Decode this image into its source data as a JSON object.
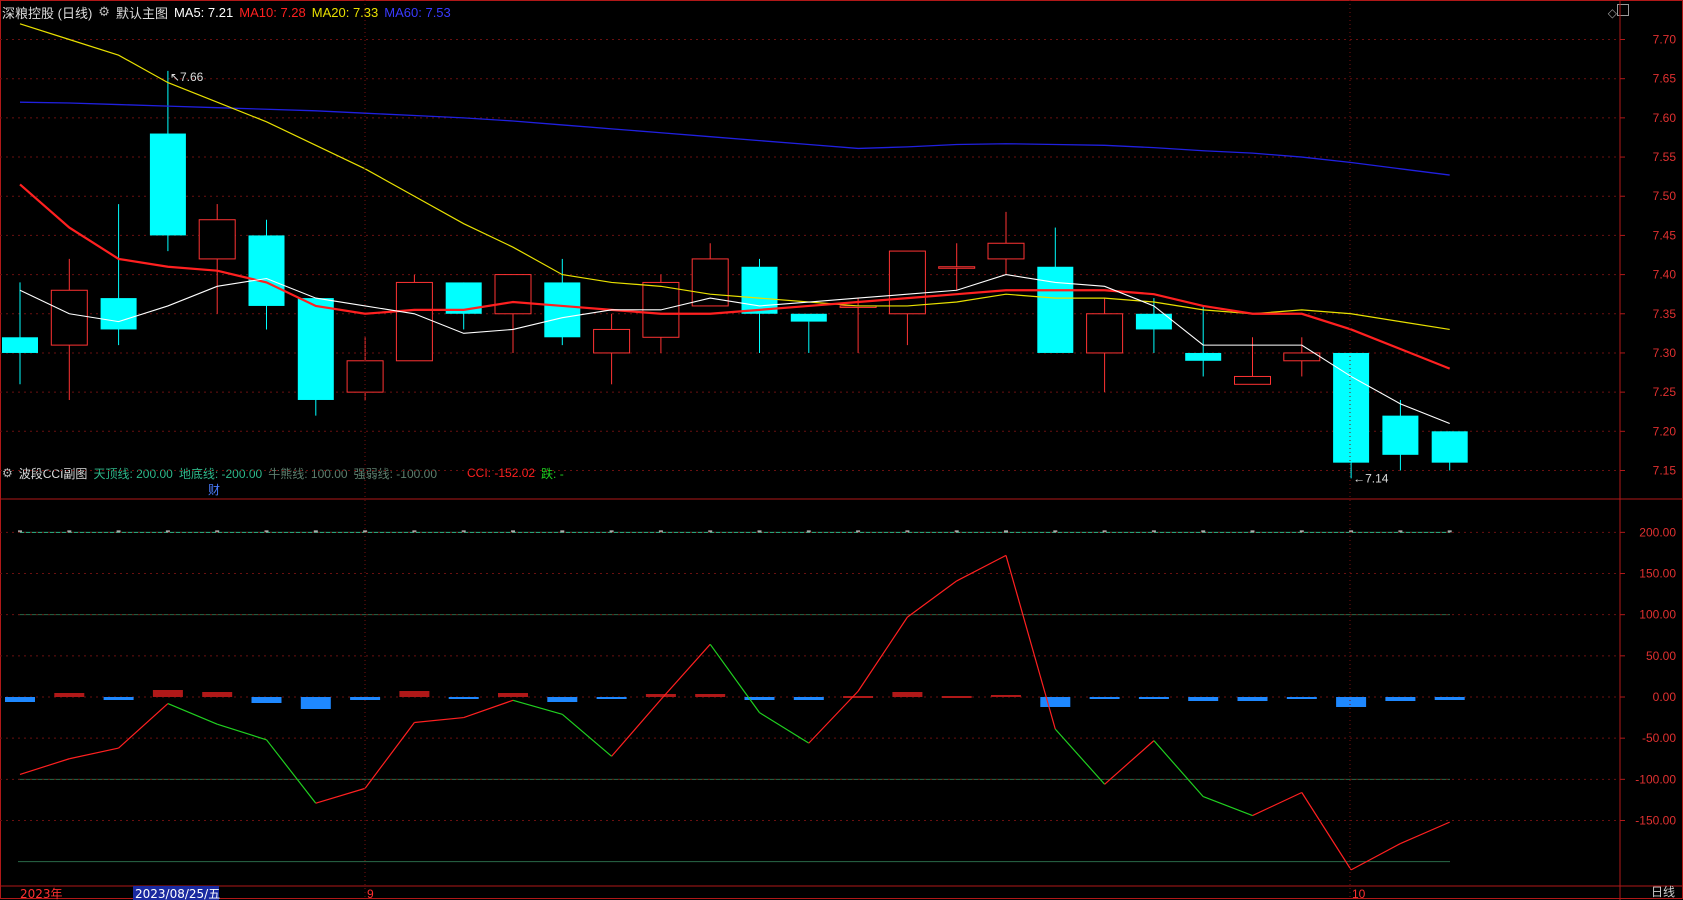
{
  "header": {
    "stock": "深粮控股 (日线)",
    "main_chart": "默认主图",
    "ma": [
      {
        "label": "MA5:",
        "value": "7.21",
        "color": "#ffffff"
      },
      {
        "label": "MA10:",
        "value": "7.28",
        "color": "#ff2020"
      },
      {
        "label": "MA20:",
        "value": "7.33",
        "color": "#e8e000"
      },
      {
        "label": "MA60:",
        "value": "7.53",
        "color": "#2a2aff"
      }
    ]
  },
  "sub_header": {
    "title": "波段CCI副图",
    "items": [
      {
        "label": "天顶线:",
        "value": "200.00",
        "color": "#2fb88a"
      },
      {
        "label": "地底线:",
        "value": "-200.00",
        "color": "#2fb88a"
      },
      {
        "label": "牛熊线:",
        "value": "100.00",
        "color": "#5e7f6e"
      },
      {
        "label": "强弱线:",
        "value": "-100.00",
        "color": "#5e7f6e"
      },
      {
        "label": "CCI:",
        "value": "-152.02",
        "color": "#ff2020"
      },
      {
        "label": "跌:",
        "value": "-",
        "color": "#20d020"
      }
    ]
  },
  "annotations": {
    "high_label": "7.66",
    "low_label": "7.14",
    "fin_marker": "财"
  },
  "x_labels": [
    {
      "text": "2023年",
      "color": "#ff3030"
    },
    {
      "text": "2023/08/25/五",
      "color": "#ffffff",
      "highlight": true
    },
    {
      "text": "9",
      "color": "#ff3030"
    },
    {
      "text": "10",
      "color": "#ff3030"
    }
  ],
  "period_tab": "日线",
  "colors": {
    "up": "#ff3333",
    "down": "#00ffff",
    "ma5": "#ffffff",
    "ma10": "#ff2020",
    "ma20": "#e8e000",
    "ma60": "#2020e0",
    "axis": "#b01818"
  },
  "chart_data": [
    {
      "type": "candlestick",
      "title": "深粮控股 (日线)",
      "ylim": [
        7.12,
        7.73
      ],
      "y_ticks": [
        7.15,
        7.2,
        7.25,
        7.3,
        7.35,
        7.4,
        7.45,
        7.5,
        7.55,
        7.6,
        7.65,
        7.7
      ],
      "ohlc": [
        [
          7.32,
          7.39,
          7.26,
          7.3
        ],
        [
          7.31,
          7.42,
          7.24,
          7.38
        ],
        [
          7.37,
          7.49,
          7.31,
          7.33
        ],
        [
          7.58,
          7.66,
          7.43,
          7.45
        ],
        [
          7.42,
          7.49,
          7.35,
          7.47
        ],
        [
          7.45,
          7.47,
          7.33,
          7.36
        ],
        [
          7.37,
          7.37,
          7.22,
          7.24
        ],
        [
          7.25,
          7.32,
          7.24,
          7.29
        ],
        [
          7.29,
          7.4,
          7.29,
          7.39
        ],
        [
          7.39,
          7.39,
          7.33,
          7.35
        ],
        [
          7.35,
          7.4,
          7.3,
          7.4
        ],
        [
          7.39,
          7.42,
          7.31,
          7.32
        ],
        [
          7.3,
          7.35,
          7.26,
          7.33
        ],
        [
          7.32,
          7.4,
          7.3,
          7.39
        ],
        [
          7.36,
          7.44,
          7.36,
          7.42
        ],
        [
          7.41,
          7.42,
          7.3,
          7.35
        ],
        [
          7.35,
          7.34,
          7.3,
          7.34
        ],
        [
          7.36,
          7.37,
          7.3,
          7.36
        ],
        [
          7.35,
          7.43,
          7.31,
          7.43
        ],
        [
          7.41,
          7.44,
          7.38,
          7.41
        ],
        [
          7.42,
          7.48,
          7.4,
          7.44
        ],
        [
          7.41,
          7.46,
          7.3,
          7.3
        ],
        [
          7.3,
          7.37,
          7.25,
          7.35
        ],
        [
          7.35,
          7.37,
          7.3,
          7.33
        ],
        [
          7.3,
          7.36,
          7.27,
          7.29
        ],
        [
          7.26,
          7.32,
          7.26,
          7.27
        ],
        [
          7.29,
          7.32,
          7.27,
          7.3
        ],
        [
          7.3,
          7.3,
          7.14,
          7.16
        ],
        [
          7.22,
          7.24,
          7.15,
          7.17
        ],
        [
          7.2,
          7.2,
          7.15,
          7.16
        ]
      ],
      "ma5": [
        7.38,
        7.35,
        7.34,
        7.36,
        7.385,
        7.395,
        7.37,
        7.36,
        7.35,
        7.325,
        7.33,
        7.345,
        7.355,
        7.355,
        7.37,
        7.36,
        7.365,
        7.37,
        7.375,
        7.38,
        7.4,
        7.39,
        7.385,
        7.36,
        7.31,
        7.31,
        7.31,
        7.27,
        7.235,
        7.21
      ],
      "ma10": [
        7.515,
        7.46,
        7.42,
        7.41,
        7.405,
        7.39,
        7.36,
        7.35,
        7.355,
        7.355,
        7.365,
        7.36,
        7.355,
        7.35,
        7.35,
        7.355,
        7.36,
        7.365,
        7.37,
        7.375,
        7.38,
        7.38,
        7.38,
        7.375,
        7.36,
        7.35,
        7.35,
        7.33,
        7.305,
        7.28
      ],
      "ma20": [
        7.72,
        7.7,
        7.68,
        7.645,
        7.62,
        7.595,
        7.565,
        7.535,
        7.5,
        7.465,
        7.435,
        7.4,
        7.39,
        7.385,
        7.375,
        7.37,
        7.365,
        7.36,
        7.36,
        7.365,
        7.375,
        7.37,
        7.37,
        7.365,
        7.355,
        7.35,
        7.355,
        7.35,
        7.34,
        7.33
      ],
      "ma60": [
        7.62,
        7.619,
        7.617,
        7.615,
        7.613,
        7.611,
        7.609,
        7.606,
        7.603,
        7.6,
        7.596,
        7.591,
        7.586,
        7.581,
        7.576,
        7.571,
        7.566,
        7.561,
        7.563,
        7.566,
        7.567,
        7.566,
        7.565,
        7.562,
        7.558,
        7.555,
        7.55,
        7.543,
        7.535,
        7.527
      ]
    },
    {
      "type": "line",
      "title": "波段CCI副图",
      "ylim": [
        -215,
        215
      ],
      "y_ticks": [
        200,
        150,
        100,
        50,
        0,
        -50,
        -100,
        -150
      ],
      "ref_lines": [
        200,
        100,
        -100,
        -200
      ],
      "cci": [
        -94,
        -75,
        -62,
        -8,
        -33,
        -52,
        -129,
        -111,
        -31,
        -25,
        -4,
        -21,
        -72,
        -3,
        64,
        -19,
        -56,
        7,
        97,
        141,
        172,
        -39,
        -106,
        -53,
        -121,
        -144,
        -116,
        -210,
        -178,
        -152
      ],
      "seg_colors": [
        "#ff2020",
        "#ff2020",
        "#ff2020",
        "#20d020",
        "#20d020",
        "#20d020",
        "#ff2020",
        "#ff2020",
        "#ff2020",
        "#ff2020",
        "#20d020",
        "#20d020",
        "#ff2020",
        "#ff2020",
        "#20d020",
        "#20d020",
        "#ff2020",
        "#ff2020",
        "#ff2020",
        "#ff2020",
        "#ff2020",
        "#20d020",
        "#ff2020",
        "#20d020",
        "#20d020",
        "#ff2020",
        "#ff2020",
        "#ff2020",
        "#ff2020"
      ],
      "bars": [
        -5,
        4,
        -3,
        7,
        5,
        -6,
        -12,
        -3,
        6,
        -1,
        4,
        -5,
        -2,
        3,
        3,
        -3,
        -3,
        1,
        5,
        1,
        2,
        -10,
        -2,
        -2,
        -4,
        -4,
        -1,
        -10,
        -4,
        -3
      ]
    }
  ]
}
